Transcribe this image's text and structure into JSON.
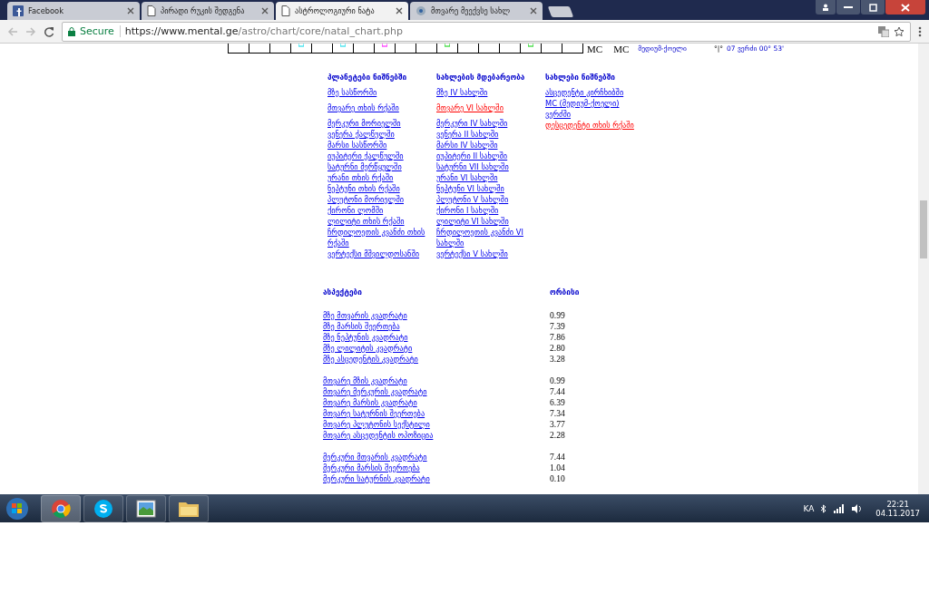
{
  "browser": {
    "tabs": [
      {
        "kind": "facebook",
        "title": "Facebook",
        "selected": false
      },
      {
        "kind": "page",
        "title": "პირადი რუკის შედგენა",
        "selected": false
      },
      {
        "kind": "page",
        "title": "ასტროლოგიური ნატა",
        "selected": true
      },
      {
        "kind": "loading",
        "title": "მთვარე მეექვსე სახლ",
        "selected": false
      }
    ],
    "security": "Secure",
    "url_host": "https://www.mental.ge",
    "url_path": "/astro/chart/core/natal_chart.php"
  },
  "top_strip": {
    "cells": [
      "",
      "",
      "",
      "",
      "",
      "",
      "",
      "",
      "",
      "",
      "",
      "",
      "",
      "",
      "",
      "",
      ""
    ],
    "labels": [
      "MC",
      "MC"
    ],
    "house_name": "მედიუმ-ქოელი",
    "mark": "°|°",
    "position": "07 ვერძი 00° 53'"
  },
  "columns": [
    {
      "heading": "პლანეტები ნიშნებში",
      "groups": [
        [
          {
            "text": "მზე სასწორში",
            "highlighted": false
          }
        ],
        [
          {
            "text": "მთვარე თხის რქაში",
            "highlighted": false
          }
        ],
        [
          {
            "text": "მერკური მორიელში",
            "highlighted": false
          },
          {
            "text": "ვენერა ქალწულში",
            "highlighted": false
          },
          {
            "text": "მარსი სასწორში",
            "highlighted": false
          },
          {
            "text": "იუპიტერი ქალწულში",
            "highlighted": false
          },
          {
            "text": "სატურნი მერწყულში",
            "highlighted": false
          },
          {
            "text": "ურანი თხის რქაში",
            "highlighted": false
          },
          {
            "text": "ნეპტუნი თხის რქაში",
            "highlighted": false
          },
          {
            "text": "პლუტონი მორიელში",
            "highlighted": false
          },
          {
            "text": "ქირონი ლომში",
            "highlighted": false
          },
          {
            "text": "ლილიტი თხის რქაში",
            "highlighted": false
          },
          {
            "text": "ჩრდილოეთის კვანძი თხის რქაში",
            "highlighted": false
          },
          {
            "text": "ვერტექსი მშვილდოსანში",
            "highlighted": false
          }
        ]
      ]
    },
    {
      "heading": "სახლების მდებარეობა",
      "groups": [
        [
          {
            "text": "მზე IV სახლში",
            "highlighted": false
          }
        ],
        [
          {
            "text": "მთვარე VI სახლში",
            "highlighted": true
          }
        ],
        [
          {
            "text": "მერკური IV სახლში",
            "highlighted": false
          },
          {
            "text": "ვენერა II სახლში",
            "highlighted": false
          },
          {
            "text": "მარსი IV სახლში",
            "highlighted": false
          },
          {
            "text": "იუპიტერი II სახლში",
            "highlighted": false
          },
          {
            "text": "სატურნი VII სახლში",
            "highlighted": false
          },
          {
            "text": "ურანი VI სახლში",
            "highlighted": false
          },
          {
            "text": "ნეპტუნი VI სახლში",
            "highlighted": false
          },
          {
            "text": "პლუტონი V სახლში",
            "highlighted": false
          },
          {
            "text": "ქირონი I სახლში",
            "highlighted": false
          },
          {
            "text": "ლილიტი VI სახლში",
            "highlighted": false
          },
          {
            "text": "ჩრდილოეთის კვანძი VI სახლში",
            "highlighted": false
          },
          {
            "text": "ვერტექსი V სახლში",
            "highlighted": false
          }
        ]
      ]
    },
    {
      "heading": "სახლები ნიშნებში",
      "groups": [
        [
          {
            "text": "ასცედენტი კირჩხიბში",
            "highlighted": false
          },
          {
            "text": "MC (მედიუმ-ქოელი)",
            "highlighted": false
          },
          {
            "text": "ვერძში",
            "highlighted": false
          },
          {
            "text": "დესცედენტი თხის რქაში",
            "highlighted": true
          }
        ]
      ]
    }
  ],
  "aspects": {
    "columns": [
      "ასპექტები",
      "ორბისი"
    ],
    "groups": [
      [
        {
          "aspect": "მზე მთვარის კვადრატი",
          "orb": "0.99"
        },
        {
          "aspect": "მზე მარსის შეერთება",
          "orb": "7.39"
        },
        {
          "aspect": "მზე ნეპტუნის კვადრატი",
          "orb": "7.86"
        },
        {
          "aspect": "მზე ლილიტის კვადრატი",
          "orb": "2.80"
        },
        {
          "aspect": "მზე ასცედენტის კვადრატი",
          "orb": "3.28"
        }
      ],
      [
        {
          "aspect": "მთვარე მზის კვადრატი",
          "orb": "0.99"
        },
        {
          "aspect": "მთვარე მერკურის კვადრატი",
          "orb": "7.44"
        },
        {
          "aspect": "მთვარე მარსის კვადრატი",
          "orb": "6.39"
        },
        {
          "aspect": "მთვარე სატურნის შეერთება",
          "orb": "7.34"
        },
        {
          "aspect": "მთვარე პლუტონის სექსტილი",
          "orb": "3.77"
        },
        {
          "aspect": "მთვარე ასცედენტის ოპოზიცია",
          "orb": "2.28"
        }
      ],
      [
        {
          "aspect": "მერკური მთვარის კვადრატი",
          "orb": "7.44"
        },
        {
          "aspect": "მერკური მარსის შეერთება",
          "orb": "1.04"
        },
        {
          "aspect": "მერკური სატურნის კვადრატი",
          "orb": "0.10"
        }
      ]
    ]
  },
  "taskbar": {
    "apps": [
      {
        "kind": "chrome",
        "selected": true
      },
      {
        "kind": "skype",
        "selected": false
      },
      {
        "kind": "photos",
        "selected": false
      },
      {
        "kind": "folder",
        "selected": false
      }
    ],
    "language": "KA",
    "time": "22:21",
    "date": "04.11.2017"
  }
}
